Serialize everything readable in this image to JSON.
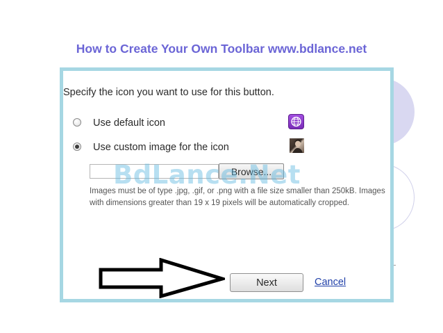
{
  "slide": {
    "title": "How to Create Your Own Toolbar www.bdlance.net"
  },
  "dialog": {
    "prompt": "Specify the icon you want to use for this button.",
    "options": [
      {
        "label": "Use default icon",
        "selected": false,
        "icon": "globe-icon"
      },
      {
        "label": "Use custom image for the icon",
        "selected": true,
        "icon": "photo-thumbnail-icon"
      }
    ],
    "file_input_value": "",
    "browse_label": "Browse...",
    "note": "Images must be of type .jpg, .gif, or .png with a file size smaller than 250kB. Images with dimensions greater than 19 x 19 pixels will be automatically cropped.",
    "next_label": "Next",
    "cancel_label": "Cancel"
  },
  "watermark": "BdLance.Net",
  "colors": {
    "title": "#6b65d6",
    "frame_border": "#a6d7e3",
    "link": "#1f3fa8",
    "watermark": "#5fb9e1"
  }
}
